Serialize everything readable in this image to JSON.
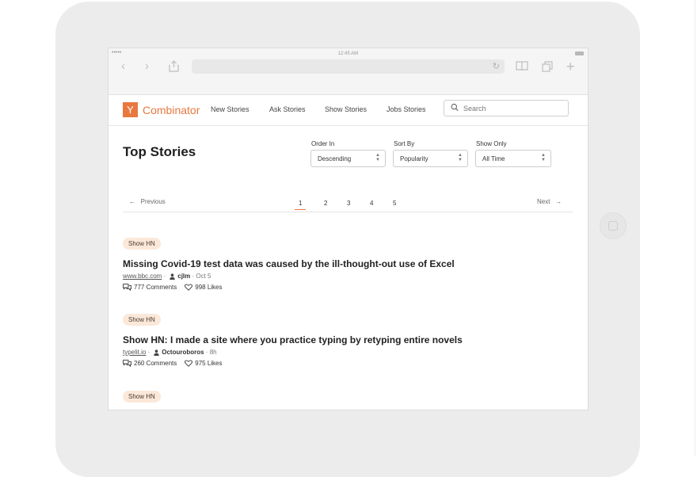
{
  "statusbar": {
    "time": "12:45 AM",
    "signal": "•••••"
  },
  "header": {
    "logo_letter": "Y",
    "logo_text": "Combinator",
    "nav": [
      "New Stories",
      "Ask Stories",
      "Show Stories",
      "Jobs Stories"
    ],
    "search_placeholder": "Search"
  },
  "page_title": "Top Stories",
  "controls": {
    "order_label": "Order In",
    "order_value": "Descending",
    "sort_label": "Sort By",
    "sort_value": "Popularity",
    "show_label": "Show Only",
    "show_value": "All Time"
  },
  "pagination": {
    "prev": "Previous",
    "next": "Next",
    "pages": [
      "1",
      "2",
      "3",
      "4",
      "5"
    ],
    "active": "1"
  },
  "stories": [
    {
      "tag": "Show HN",
      "title": "Missing Covid-19 test data was caused by the ill-thought-out use of Excel",
      "domain": "www.bbc.com",
      "author": "cjlm",
      "time": "Oct 5",
      "comments": "777 Comments",
      "likes": "998 Likes"
    },
    {
      "tag": "Show HN",
      "title": "Show HN: I made a site where you practice typing by retyping entire novels",
      "domain": "typelit.io",
      "author": "Octouroboros",
      "time": "8h",
      "comments": "260 Comments",
      "likes": "975 Likes"
    },
    {
      "tag": "Show HN"
    }
  ],
  "colors": {
    "accent": "#e8783f",
    "tag_bg": "#fbe8d9",
    "device": "#ececec"
  }
}
